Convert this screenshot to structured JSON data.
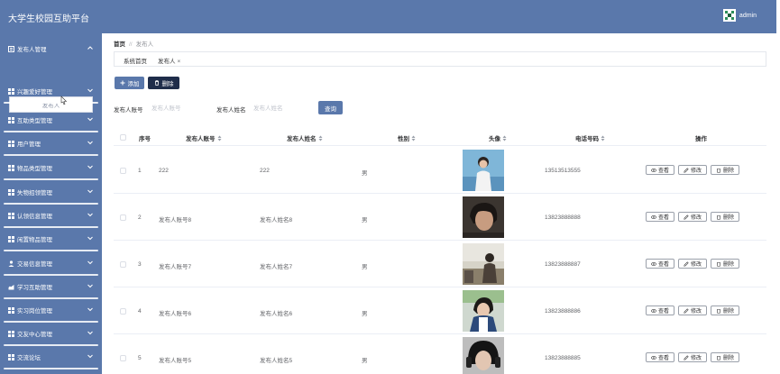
{
  "header": {
    "app_title": "大学生校园互助平台",
    "user_name": "admin",
    "bg_color": "#5a78ab"
  },
  "sidebar": {
    "submenu_item": "发布人",
    "items": [
      {
        "label": "发布人管理",
        "icon": "user-manage-icon",
        "expanded": true
      },
      {
        "label": "兴趣爱好管理",
        "icon": "grid-icon"
      },
      {
        "label": "互助类型管理",
        "icon": "grid-icon"
      },
      {
        "label": "用户管理",
        "icon": "grid-icon"
      },
      {
        "label": "物品类型管理",
        "icon": "grid-icon"
      },
      {
        "label": "失物招领管理",
        "icon": "grid-icon"
      },
      {
        "label": "认领信息管理",
        "icon": "grid-icon"
      },
      {
        "label": "闲置物品管理",
        "icon": "grid-icon"
      },
      {
        "label": "交易信息管理",
        "icon": "person-icon"
      },
      {
        "label": "学习互助管理",
        "icon": "hand-icon"
      },
      {
        "label": "实习岗位管理",
        "icon": "grid-icon"
      },
      {
        "label": "交友中心管理",
        "icon": "grid-icon"
      },
      {
        "label": "交流论坛",
        "icon": "grid-icon"
      }
    ]
  },
  "breadcrumb": {
    "home": "首页",
    "separator": "//",
    "current": "发布人"
  },
  "tabs": {
    "home_tab": "系统首页",
    "current_tab": "发布人",
    "close_glyph": "×"
  },
  "toolbar": {
    "add_label": "添加",
    "delete_label": "删除"
  },
  "search": {
    "account_label": "发布人账号",
    "account_placeholder": "发布人账号",
    "name_label": "发布人姓名",
    "name_placeholder": "发布人姓名",
    "query_label": "查询"
  },
  "table": {
    "columns": {
      "index": "序号",
      "account": "发布人账号",
      "name": "发布人姓名",
      "gender": "性别",
      "avatar": "头像",
      "phone": "电话号码",
      "actions": "操作"
    },
    "action_labels": {
      "view": "查看",
      "edit": "修改",
      "delete": "删除"
    },
    "rows": [
      {
        "index": "1",
        "account": "222",
        "name": "222",
        "gender": "男",
        "phone": "13513513555"
      },
      {
        "index": "2",
        "account": "发布人账号8",
        "name": "发布人姓名8",
        "gender": "男",
        "phone": "13823888888"
      },
      {
        "index": "3",
        "account": "发布人账号7",
        "name": "发布人姓名7",
        "gender": "男",
        "phone": "13823888887"
      },
      {
        "index": "4",
        "account": "发布人账号6",
        "name": "发布人姓名6",
        "gender": "男",
        "phone": "13823888886"
      },
      {
        "index": "5",
        "account": "发布人账号5",
        "name": "发布人姓名5",
        "gender": "男",
        "phone": "13823888885"
      }
    ]
  },
  "colors": {
    "accent": "#5a78ab",
    "dark_button": "#1f2d4a"
  }
}
